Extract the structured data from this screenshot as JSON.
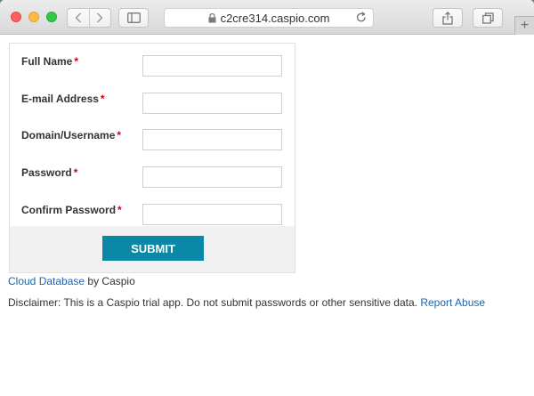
{
  "browser": {
    "address_url": "c2cre314.caspio.com",
    "new_tab_symbol": "+"
  },
  "form": {
    "fields": [
      {
        "label": "Full Name",
        "required_mark": "*",
        "value": ""
      },
      {
        "label": "E-mail Address",
        "required_mark": "*",
        "value": ""
      },
      {
        "label": "Domain/Username",
        "required_mark": "*",
        "value": ""
      },
      {
        "label": "Password",
        "required_mark": "*",
        "value": ""
      },
      {
        "label": "Confirm Password",
        "required_mark": "*",
        "value": ""
      }
    ],
    "submit_label": "SUBMIT"
  },
  "footer": {
    "cloud_link": "Cloud Database",
    "by_text": "by Caspio",
    "disclaimer": "Disclaimer: This is a Caspio trial app. Do not submit passwords or other sensitive data.",
    "report_link": "Report Abuse"
  },
  "colors": {
    "accent": "#0a88a5",
    "link": "#1c64ad",
    "required": "#d0021b"
  },
  "icons": [
    "back-icon",
    "forward-icon",
    "sidebar-icon",
    "lock-icon",
    "reload-icon",
    "share-icon",
    "tabs-icon"
  ]
}
